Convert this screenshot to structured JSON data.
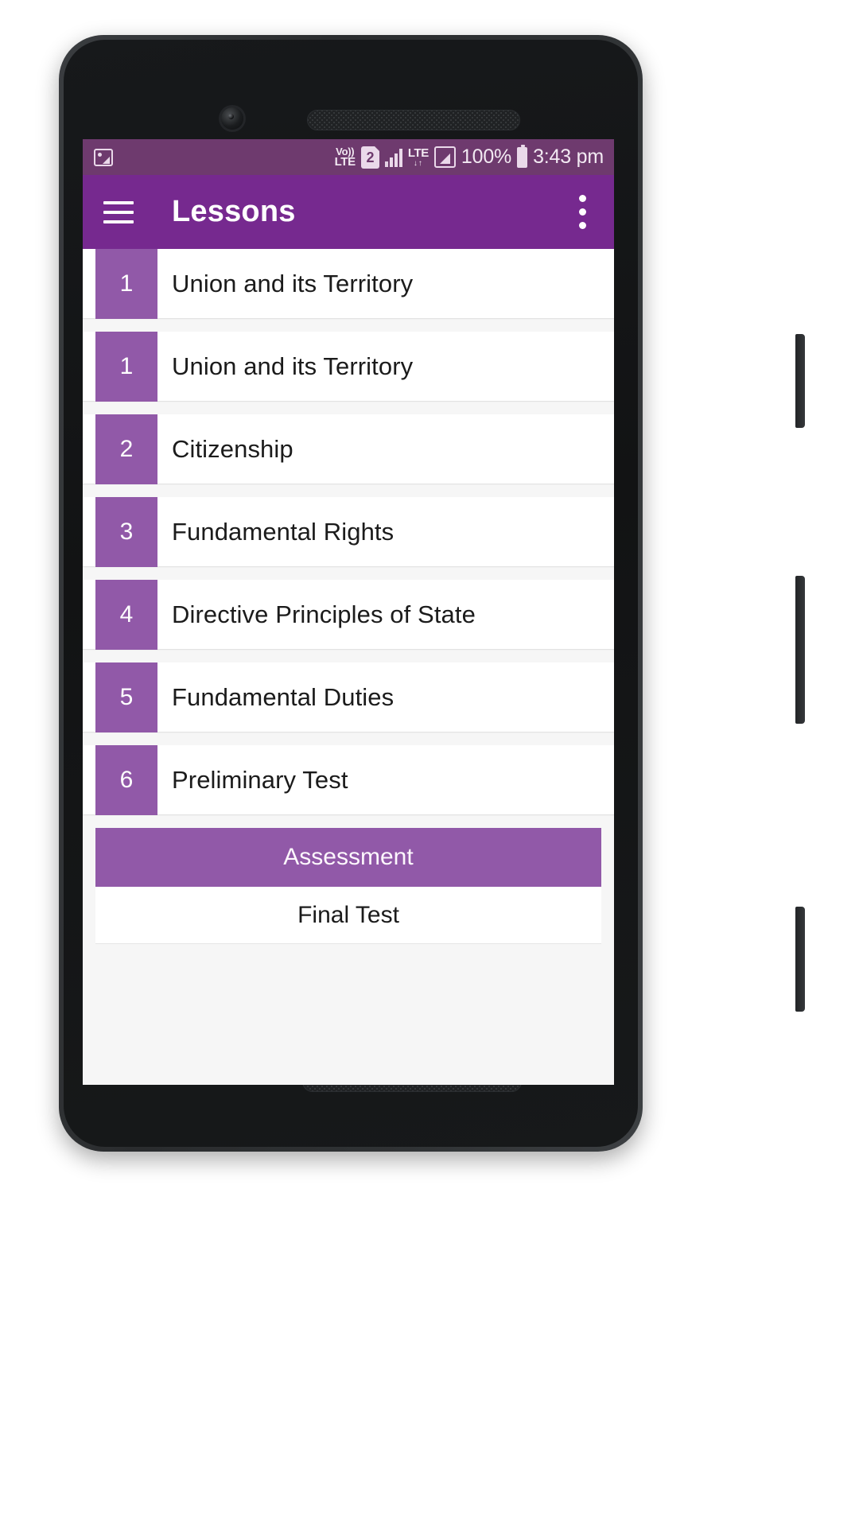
{
  "statusbar": {
    "photo_icon": "photo-icon",
    "volte_top": "Vo))",
    "volte_bottom": "LTE",
    "sim_label": "2",
    "lte_label": "LTE",
    "lte_arrows": "↓↑",
    "battery_percent": "100%",
    "time": "3:43 pm"
  },
  "appbar": {
    "menu_icon": "hamburger-menu-icon",
    "title": "Lessons",
    "overflow_icon": "overflow-menu-icon"
  },
  "lessons": [
    {
      "number": "1",
      "title": "Union and its Territory"
    },
    {
      "number": "1",
      "title": "Union and its Territory"
    },
    {
      "number": "2",
      "title": "Citizenship"
    },
    {
      "number": "3",
      "title": "Fundamental Rights"
    },
    {
      "number": "4",
      "title": "Directive Principles of State"
    },
    {
      "number": "5",
      "title": "Fundamental Duties"
    },
    {
      "number": "6",
      "title": "Preliminary Test"
    }
  ],
  "assessment": {
    "header": "Assessment",
    "items": [
      {
        "title": "Final Test"
      }
    ]
  },
  "colors": {
    "statusbar_bg": "#6e3a6e",
    "appbar_bg": "#76298f",
    "badge_bg": "#9159a8",
    "accent": "#9159a8",
    "page_bg": "#f6f6f6"
  }
}
